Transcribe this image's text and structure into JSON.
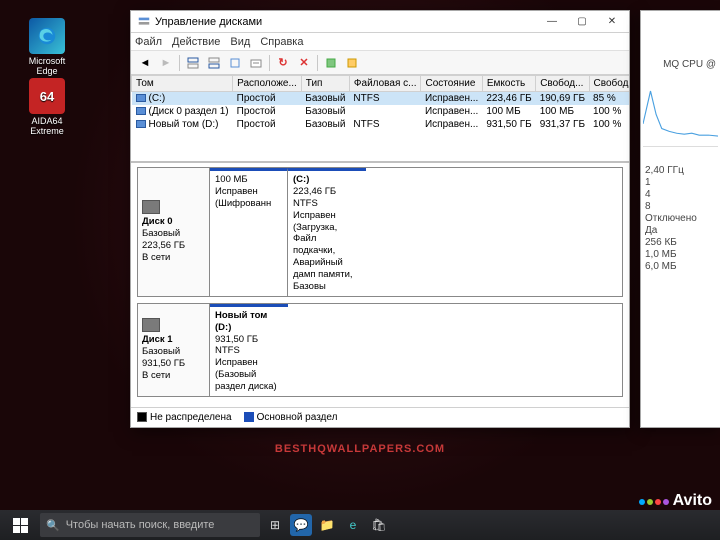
{
  "desktop_icons": [
    {
      "label": "Microsoft Edge",
      "color": "#1a8ad6"
    },
    {
      "label": "AIDA64 Extreme",
      "color": "#c42424"
    }
  ],
  "watermark": "BESTHQWALLPAPERS.COM",
  "avito": "Avito",
  "window": {
    "title": "Управление дисками",
    "menu": [
      "Файл",
      "Действие",
      "Вид",
      "Справка"
    ],
    "columns": [
      "Том",
      "Расположе...",
      "Тип",
      "Файловая с...",
      "Состояние",
      "Емкость",
      "Свобод...",
      "Свободно %"
    ],
    "volumes": [
      {
        "name": "(C:)",
        "layout": "Простой",
        "type": "Базовый",
        "fs": "NTFS",
        "status": "Исправен...",
        "cap": "223,46 ГБ",
        "free": "190,69 ГБ",
        "pct": "85 %",
        "sel": true
      },
      {
        "name": "(Диск 0 раздел 1)",
        "layout": "Простой",
        "type": "Базовый",
        "fs": "",
        "status": "Исправен...",
        "cap": "100 МБ",
        "free": "100 МБ",
        "pct": "100 %",
        "sel": false
      },
      {
        "name": "Новый том (D:)",
        "layout": "Простой",
        "type": "Базовый",
        "fs": "NTFS",
        "status": "Исправен...",
        "cap": "931,50 ГБ",
        "free": "931,37 ГБ",
        "pct": "100 %",
        "sel": false
      }
    ],
    "disks": [
      {
        "head": {
          "name": "Диск 0",
          "type": "Базовый",
          "size": "223,56 ГБ",
          "status": "В сети"
        },
        "parts": [
          {
            "w": 78,
            "title": "",
            "size": "100 МБ",
            "status": "Исправен (Шифрованн"
          },
          {
            "w": 1,
            "title": "(C:)",
            "size": "223,46 ГБ NTFS",
            "status": "Исправен (Загрузка, Файл подкачки, Аварийный дамп памяти, Базовы"
          }
        ]
      },
      {
        "head": {
          "name": "Диск 1",
          "type": "Базовый",
          "size": "931,50 ГБ",
          "status": "В сети"
        },
        "parts": [
          {
            "w": 1,
            "title": "Новый том  (D:)",
            "size": "931,50 ГБ NTFS",
            "status": "Исправен (Базовый раздел диска)"
          }
        ]
      }
    ],
    "legend": [
      {
        "label": "Не распределена",
        "color": "#000",
        "fill": "#fff"
      },
      {
        "label": "Основной раздел",
        "color": "#1b4db8",
        "fill": "#1b4db8"
      }
    ]
  },
  "right_panel": {
    "cpu_fragment": "MQ CPU @",
    "freq": "2,40 ГГц",
    "rows": [
      "1",
      "4",
      "8",
      "Отключено",
      "Да",
      "256 КБ",
      "1,0 МБ",
      "6,0 МБ"
    ]
  },
  "taskbar": {
    "search_placeholder": "Чтобы начать поиск, введите"
  }
}
